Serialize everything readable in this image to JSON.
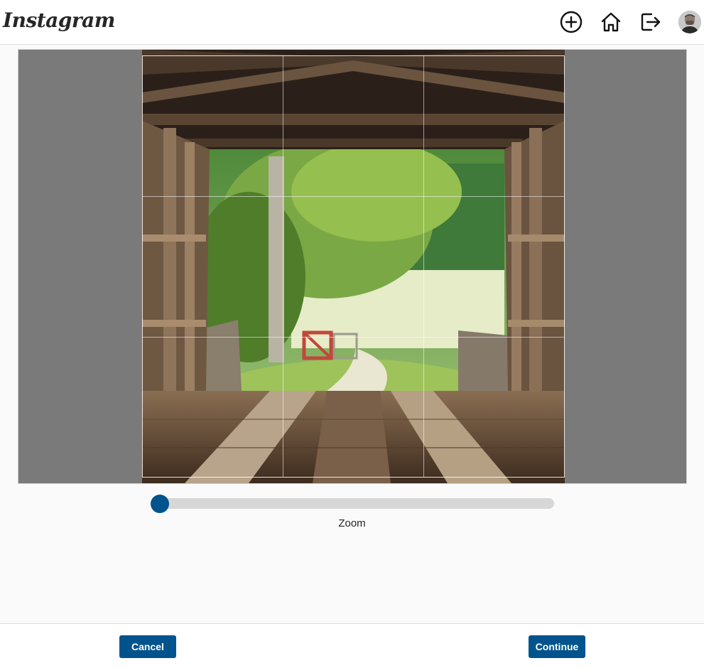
{
  "header": {
    "logo": "Instagram",
    "icons": [
      "plus-circle-icon",
      "home-icon",
      "logout-icon"
    ],
    "avatar_alt": "profile avatar"
  },
  "editor": {
    "zoom_label": "Zoom",
    "zoom_value": 0,
    "accent_color": "#00538c"
  },
  "footer": {
    "cancel_label": "Cancel",
    "continue_label": "Continue"
  }
}
